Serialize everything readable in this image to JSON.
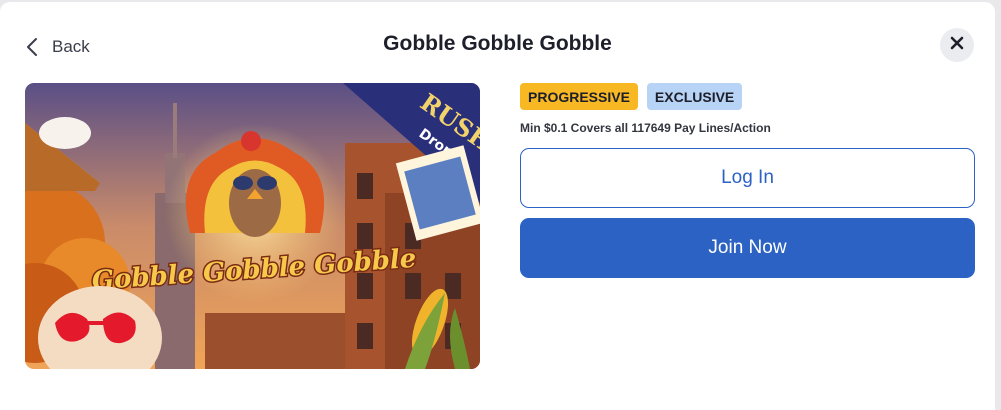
{
  "header": {
    "back_label": "Back",
    "title": "Gobble Gobble Gobble",
    "back_icon": "chevron-left-icon",
    "close_icon": "close-icon"
  },
  "game": {
    "image_title": "Gobble Gobble Gobble",
    "banner_text": "RUSH",
    "banner_sub": "Drop",
    "badges": [
      {
        "label": "PROGRESSIVE",
        "color": "#f7b824"
      },
      {
        "label": "EXCLUSIVE",
        "color": "#b7d3f5"
      }
    ],
    "subtitle": "Min $0.1 Covers all 117649 Pay Lines/Action"
  },
  "actions": {
    "login_label": "Log In",
    "join_label": "Join Now"
  },
  "colors": {
    "accent": "#2b62c3",
    "background": "#ffffff"
  }
}
